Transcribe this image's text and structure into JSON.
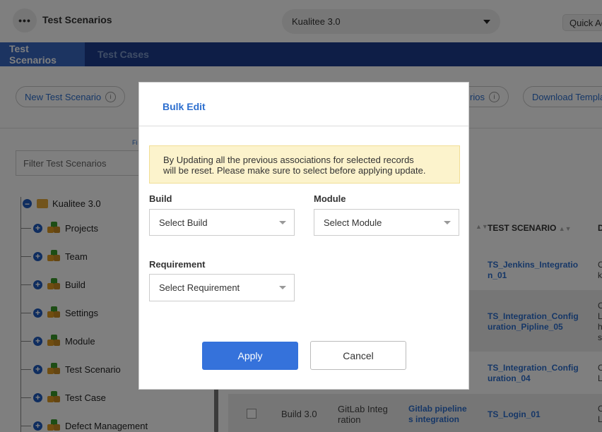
{
  "header": {
    "menu_icon": "•••",
    "title": "Test Scenarios",
    "project_select": "Kualitee 3.0",
    "quick_action": "Quick Ac"
  },
  "tabs": [
    {
      "label": "Test Scenarios",
      "active": true
    },
    {
      "label": "Test Cases",
      "active": false
    }
  ],
  "toolbar": {
    "new_scenario": "New Test Scenario",
    "partial_button": "rios",
    "download_template": "Download Templa",
    "info_icon": "i"
  },
  "filter": {
    "placeholder": "Filter Test Scenarios",
    "label_fragment": "Fi"
  },
  "tree": {
    "root": "Kualitee 3.0",
    "items": [
      "Projects",
      "Team",
      "Build",
      "Settings",
      "Module",
      "Test Scenario",
      "Test Case",
      "Defect Management"
    ]
  },
  "grid": {
    "header_scenario": "TEST SCENARIO",
    "header_partial": "D",
    "rows": [
      {
        "scenario": [
          "TS_Jenkins_Integratio",
          "n_01"
        ],
        "desc": [
          "C",
          "k"
        ]
      },
      {
        "scenario": [
          "TS_Integration_Config",
          "uration_Pipline_05"
        ],
        "desc": [
          "C",
          "L",
          "h",
          "s"
        ]
      },
      {
        "scenario": [
          "TS_Integration_Config",
          "uration_04"
        ],
        "desc": [
          "C",
          "L"
        ]
      },
      {
        "build": "Build 3.0",
        "module": [
          "GitLab Integ",
          "ration"
        ],
        "requirement": [
          "Gitlab pipeline",
          "s integration"
        ],
        "scenario": [
          "TS_Login_01"
        ],
        "desc": [
          "C",
          "L"
        ]
      }
    ]
  },
  "modal": {
    "title": "Bulk Edit",
    "warning_line1": "By Updating all the previous associations for selected records",
    "warning_line2": "will be reset. Please make sure to select before applying update.",
    "build_label": "Build",
    "build_placeholder": "Select Build",
    "module_label": "Module",
    "module_placeholder": "Select Module",
    "requirement_label": "Requirement",
    "requirement_placeholder": "Select Requirement",
    "apply": "Apply",
    "cancel": "Cancel"
  },
  "colors": {
    "tabbar": "#1c3d8f",
    "active_tab": "#3869c2",
    "link": "#2d6fcf",
    "apply_button": "#3572db",
    "warning_bg": "#fcf3cc"
  }
}
